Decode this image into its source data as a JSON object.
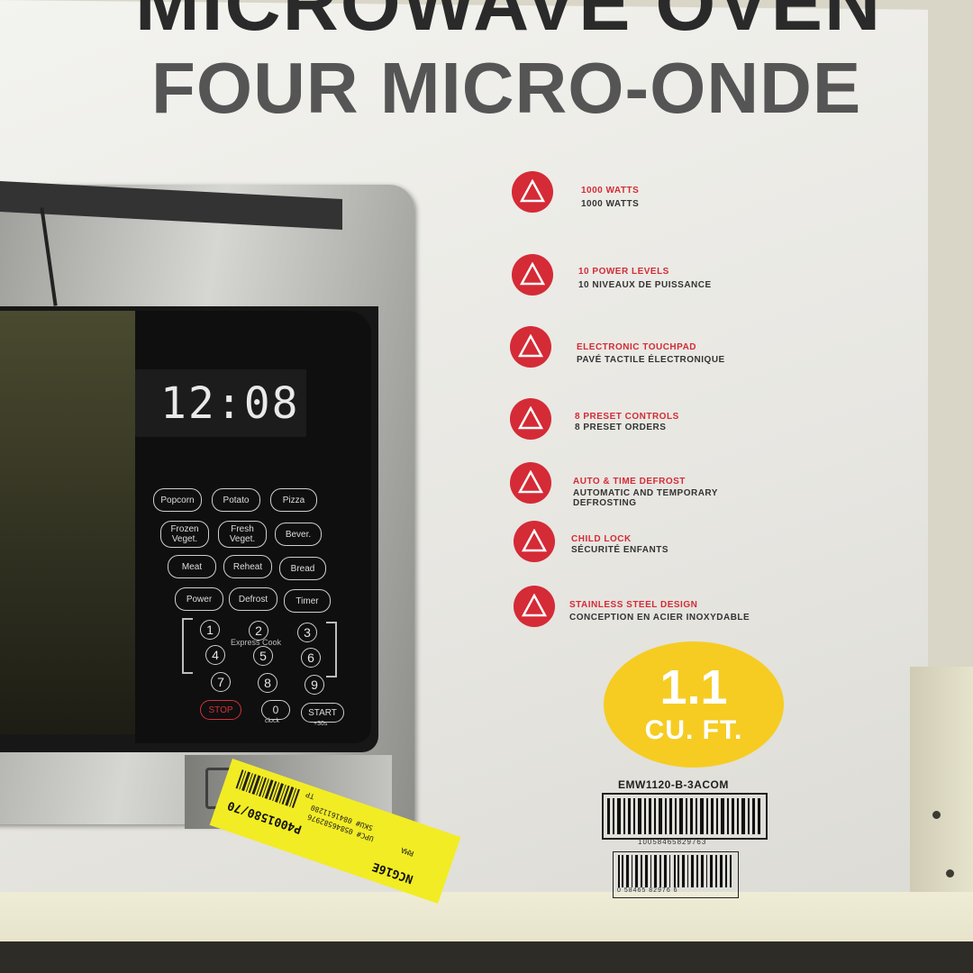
{
  "box": {
    "title_en": "MICROWAVE OVEN",
    "title_fr": "FOUR MICRO-ONDE"
  },
  "microwave": {
    "display_time": "12:08",
    "keys": [
      {
        "label": "Popcorn"
      },
      {
        "label": "Potato"
      },
      {
        "label": "Pizza"
      },
      {
        "label": "Frozen Veget."
      },
      {
        "label": "Fresh Veget."
      },
      {
        "label": "Bever."
      },
      {
        "label": "Meat"
      },
      {
        "label": "Reheat"
      },
      {
        "label": "Bread"
      },
      {
        "label": "Power"
      },
      {
        "label": "Defrost"
      },
      {
        "label": "Timer"
      }
    ],
    "numbers": [
      "1",
      "2",
      "3",
      "4",
      "5",
      "6",
      "7",
      "8",
      "9"
    ],
    "express_cook": "Express Cook",
    "stop": "STOP",
    "zero": "0",
    "zero_sub": "clock",
    "start": "START",
    "start_sub": "+30s"
  },
  "features": [
    {
      "en": "1000 WATTS",
      "fr": "1000 WATTS"
    },
    {
      "en": "10 POWER LEVELS",
      "fr": "10 NIVEAUX DE PUISSANCE"
    },
    {
      "en": "ELECTRONIC TOUCHPAD",
      "fr": "PAVÉ TACTILE ÉLECTRONIQUE"
    },
    {
      "en": "8 PRESET CONTROLS",
      "fr": "8 PRESET ORDERS"
    },
    {
      "en": "AUTO & TIME DEFROST",
      "fr": "AUTOMATIC AND TEMPORARY DEFROSTING"
    },
    {
      "en": "CHILD LOCK",
      "fr": "SÉCURITÉ ENFANTS"
    },
    {
      "en": "STAINLESS STEEL DESIGN",
      "fr": "CONCEPTION EN ACIER INOXYDABLE"
    }
  ],
  "capacity": {
    "number": "1.1",
    "unit": "CU. FT."
  },
  "model": "EMW1120-B-3ACOM",
  "barcode_1_number": "10058465829763",
  "barcode_2_number": "0 58465 82976 6",
  "sticker": {
    "code": "NCG16E",
    "item_number": "P4001580/70",
    "line_1": "TP",
    "line_2": "SKU# 0841611280",
    "line_3": "UPC# 05846582976",
    "line_4": "RMA"
  },
  "colors": {
    "accent_red": "#d42b36",
    "capacity_yellow": "#f6cc22",
    "sticker_yellow": "#f2ec24"
  },
  "icons": [
    "warning-triangle-icon"
  ]
}
